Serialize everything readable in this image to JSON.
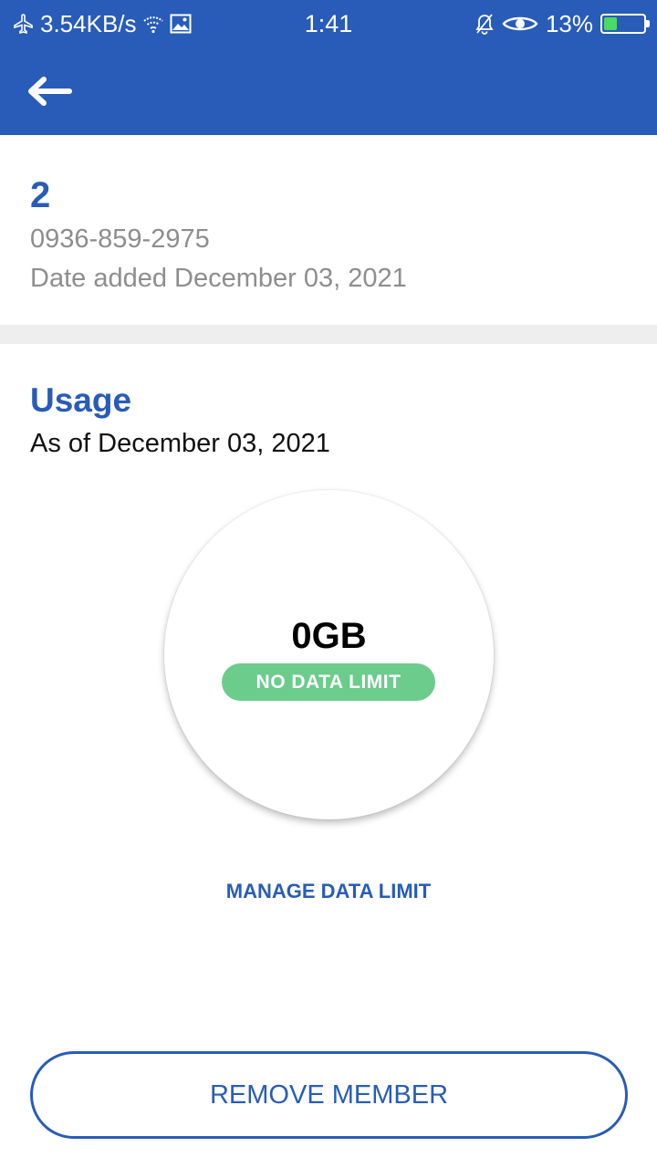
{
  "status_bar": {
    "network_speed": "3.54KB/s",
    "time": "1:41",
    "battery_percent": "13%",
    "battery_level": 0.13,
    "icons": [
      "airplane-icon",
      "wifi-icon",
      "image-icon",
      "mute-icon",
      "eye-icon",
      "battery-icon"
    ]
  },
  "member": {
    "name": "2",
    "phone": "0936-859-2975",
    "date_added": "Date added December 03, 2021"
  },
  "usage": {
    "title": "Usage",
    "as_of": "As of December 03, 2021",
    "value": "0GB",
    "limit_badge": "NO DATA LIMIT"
  },
  "actions": {
    "manage_label": "MANAGE DATA LIMIT",
    "remove_label": "REMOVE MEMBER"
  },
  "colors": {
    "brand": "#285cb8",
    "badge_green": "#6ccc8c",
    "muted_text": "#8e8e8e",
    "battery_green": "#4cd964"
  }
}
